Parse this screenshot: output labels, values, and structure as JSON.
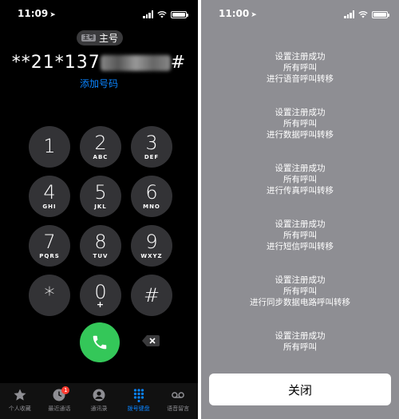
{
  "left": {
    "status": {
      "time": "11:09"
    },
    "line_badge": "主号",
    "line_label": "主号",
    "number_prefix": "**21*137",
    "number_suffix": "#",
    "add_number": "添加号码",
    "keys": [
      {
        "digit": "1",
        "letters": ""
      },
      {
        "digit": "2",
        "letters": "ABC"
      },
      {
        "digit": "3",
        "letters": "DEF"
      },
      {
        "digit": "4",
        "letters": "GHI"
      },
      {
        "digit": "5",
        "letters": "JKL"
      },
      {
        "digit": "6",
        "letters": "MNO"
      },
      {
        "digit": "7",
        "letters": "PQRS"
      },
      {
        "digit": "8",
        "letters": "TUV"
      },
      {
        "digit": "9",
        "letters": "WXYZ"
      },
      {
        "digit": "*",
        "letters": ""
      },
      {
        "digit": "0",
        "letters": "+"
      },
      {
        "digit": "#",
        "letters": ""
      }
    ],
    "tabs": [
      {
        "label": "个人收藏",
        "icon": "star-icon"
      },
      {
        "label": "最近通话",
        "icon": "clock-icon",
        "badge": "1"
      },
      {
        "label": "通讯录",
        "icon": "person-icon"
      },
      {
        "label": "拨号键盘",
        "icon": "keypad-icon"
      },
      {
        "label": "语音留言",
        "icon": "voicemail-icon"
      }
    ],
    "accent_color": "#0a84ff",
    "call_color": "#34c759"
  },
  "right": {
    "status": {
      "time": "11:00"
    },
    "messages": [
      [
        "设置注册成功",
        "所有呼叫",
        "进行语音呼叫转移"
      ],
      [
        "设置注册成功",
        "所有呼叫",
        "进行数据呼叫转移"
      ],
      [
        "设置注册成功",
        "所有呼叫",
        "进行传真呼叫转移"
      ],
      [
        "设置注册成功",
        "所有呼叫",
        "进行短信呼叫转移"
      ],
      [
        "设置注册成功",
        "所有呼叫",
        "进行同步数据电路呼叫转移"
      ],
      [
        "设置注册成功",
        "所有呼叫"
      ]
    ],
    "close_label": "关闭"
  }
}
